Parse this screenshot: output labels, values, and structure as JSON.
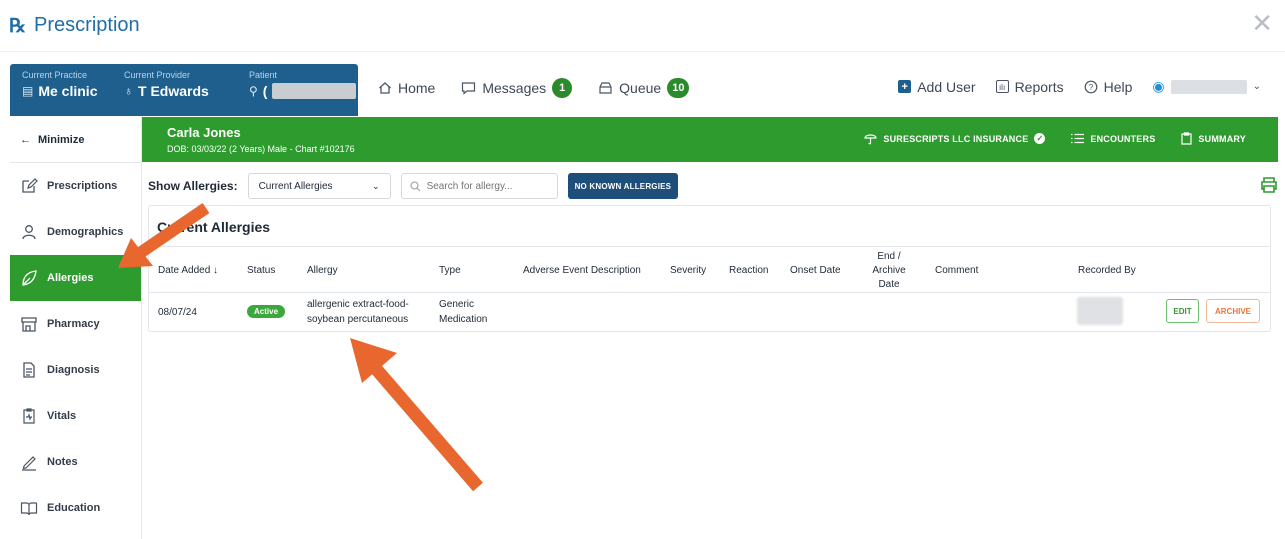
{
  "window": {
    "title": "Prescription",
    "logo_text": "℞"
  },
  "context": {
    "practice_label": "Current Practice",
    "practice_value": "Me clinic",
    "provider_label": "Current Provider",
    "provider_value": "T Edwards",
    "patient_label": "Patient",
    "patient_value": "("
  },
  "nav": {
    "home": "Home",
    "messages": "Messages",
    "messages_count": "1",
    "queue": "Queue",
    "queue_count": "10",
    "add_user": "Add User",
    "reports": "Reports",
    "help": "Help"
  },
  "sidebar": {
    "minimize_label": "Minimize",
    "items": [
      {
        "label": "Prescriptions",
        "icon": "edit-icon"
      },
      {
        "label": "Demographics",
        "icon": "person-icon"
      },
      {
        "label": "Allergies",
        "icon": "leaf-icon",
        "active": true
      },
      {
        "label": "Pharmacy",
        "icon": "store-icon"
      },
      {
        "label": "Diagnosis",
        "icon": "document-icon"
      },
      {
        "label": "Vitals",
        "icon": "clipboard-icon"
      },
      {
        "label": "Notes",
        "icon": "pencil-icon"
      },
      {
        "label": "Education",
        "icon": "book-icon"
      }
    ]
  },
  "patient_header": {
    "name": "Carla Jones",
    "details": "DOB: 03/03/22 (2 Years) Male - Chart #102176",
    "insurance": "SURESCRIPTS LLC INSURANCE",
    "encounters": "ENCOUNTERS",
    "summary": "SUMMARY"
  },
  "filter": {
    "show_label": "Show Allergies:",
    "selected": "Current Allergies",
    "search_placeholder": "Search for allergy...",
    "nka_button": "NO KNOWN ALLERGIES"
  },
  "card": {
    "title": "Current Allergies",
    "columns": {
      "date_added": "Date Added ↓",
      "status": "Status",
      "allergy": "Allergy",
      "type": "Type",
      "adverse": "Adverse Event Description",
      "severity": "Severity",
      "reaction": "Reaction",
      "onset": "Onset Date",
      "end_archive": "End / Archive Date",
      "comment": "Comment",
      "recorded_by": "Recorded By"
    },
    "rows": [
      {
        "date_added": "08/07/24",
        "status": "Active",
        "allergy": "allergenic extract-food-soybean percutaneous",
        "type": "Generic Medication",
        "edit": "EDIT",
        "archive": "ARCHIVE"
      }
    ]
  },
  "colors": {
    "brand_blue": "#1e5f8e",
    "active_green": "#2e9b2e",
    "annotation_orange": "#e8672f"
  }
}
